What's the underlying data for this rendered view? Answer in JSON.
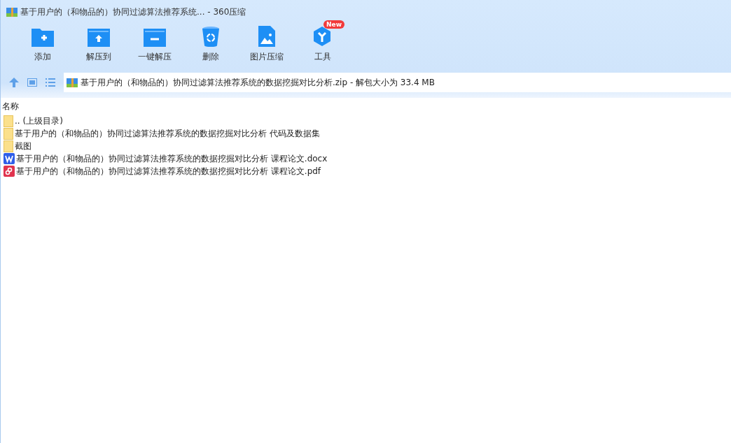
{
  "window": {
    "title": "基于用户的（和物品的）协同过滤算法推荐系统... - 360压缩"
  },
  "toolbar": [
    {
      "kind": "add",
      "label": "添加"
    },
    {
      "kind": "extract",
      "label": "解压到"
    },
    {
      "kind": "quick",
      "label": "一键解压"
    },
    {
      "kind": "delete",
      "label": "删除"
    },
    {
      "kind": "image",
      "label": "图片压缩"
    },
    {
      "kind": "tools",
      "label": "工具",
      "badge": "New"
    }
  ],
  "address": {
    "path": "基于用户的（和物品的）协同过滤算法推荐系统的数据挖掘对比分析.zip - 解包大小为 33.4 MB"
  },
  "table": {
    "columns": [
      "名称"
    ],
    "rows": [
      {
        "kind": "folder",
        "name": ".. (上级目录)"
      },
      {
        "kind": "folder",
        "name": "基于用户的（和物品的）协同过滤算法推荐系统的数据挖掘对比分析 代码及数据集"
      },
      {
        "kind": "folder",
        "name": "截图"
      },
      {
        "kind": "word",
        "name": "基于用户的（和物品的）协同过滤算法推荐系统的数据挖掘对比分析 课程论文.docx"
      },
      {
        "kind": "pdf",
        "name": "基于用户的（和物品的）协同过滤算法推荐系统的数据挖掘对比分析 课程论文.pdf"
      }
    ]
  }
}
